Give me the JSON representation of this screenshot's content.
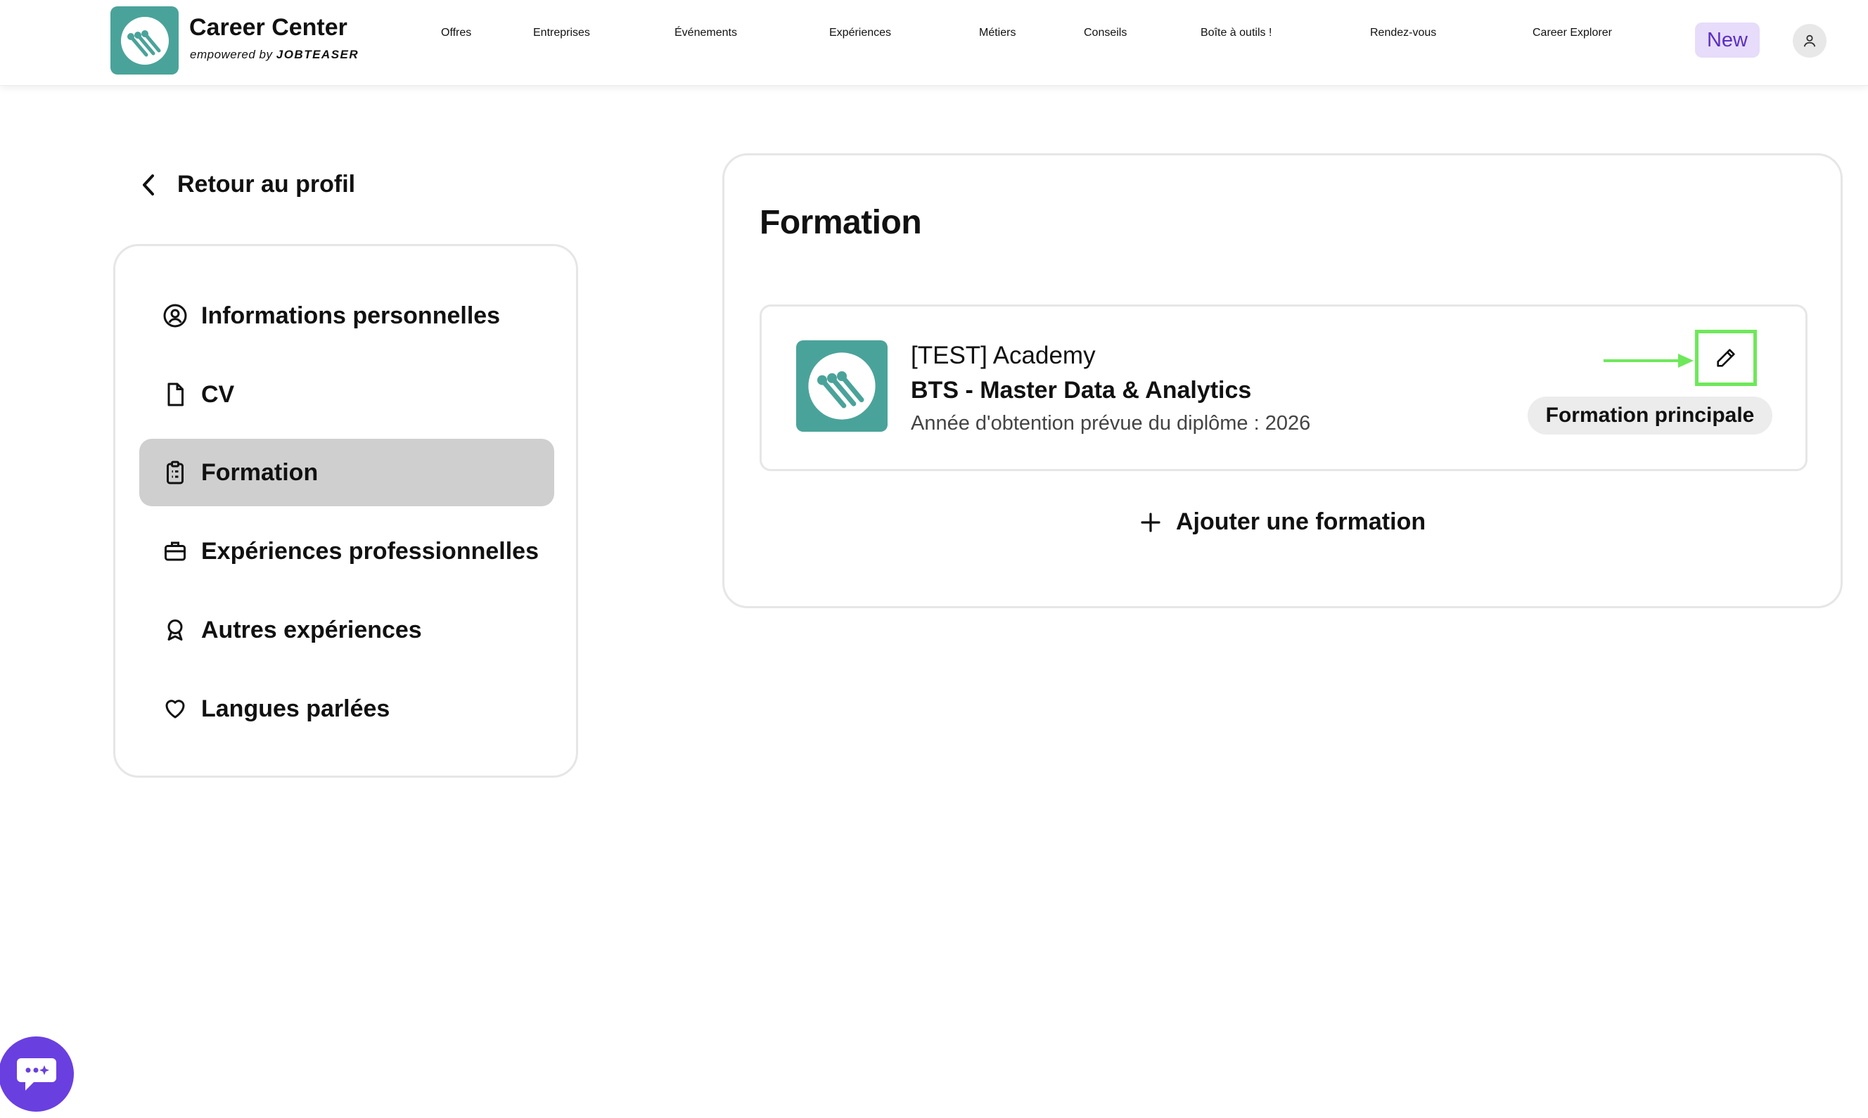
{
  "header": {
    "brand_title": "Career Center",
    "brand_sub_prefix": "empowered by",
    "brand_sub_name": "JOBTEASER",
    "nav": {
      "offres": "Offres",
      "entreprises": "Entreprises",
      "evenements": "Événements",
      "experiences": "Expériences",
      "metiers": "Métiers",
      "conseils": "Conseils",
      "boite": "Boîte à outils !",
      "rdv": "Rendez-vous",
      "explorer": "Career Explorer"
    },
    "new_badge": "New"
  },
  "back_link": "Retour au profil",
  "sidebar": {
    "items": [
      {
        "label": "Informations personnelles",
        "icon": "user-circle-icon"
      },
      {
        "label": "CV",
        "icon": "document-icon"
      },
      {
        "label": "Formation",
        "icon": "clipboard-icon",
        "active": true
      },
      {
        "label": "Expériences professionnelles",
        "icon": "briefcase-icon"
      },
      {
        "label": "Autres expériences",
        "icon": "award-icon"
      },
      {
        "label": "Langues parlées",
        "icon": "heart-icon"
      }
    ]
  },
  "main": {
    "title": "Formation",
    "education": {
      "school": "[TEST] Academy",
      "degree": "BTS - Master Data & Analytics",
      "year": "Année d'obtention prévue du diplôme : 2026",
      "badge": "Formation principale"
    },
    "add_label": "Ajouter une formation"
  },
  "colors": {
    "brand_teal": "#4aa39a",
    "accent_purple": "#6a3fe0",
    "highlight_green": "#6ee85a",
    "active_bg": "#cfcfcf"
  }
}
